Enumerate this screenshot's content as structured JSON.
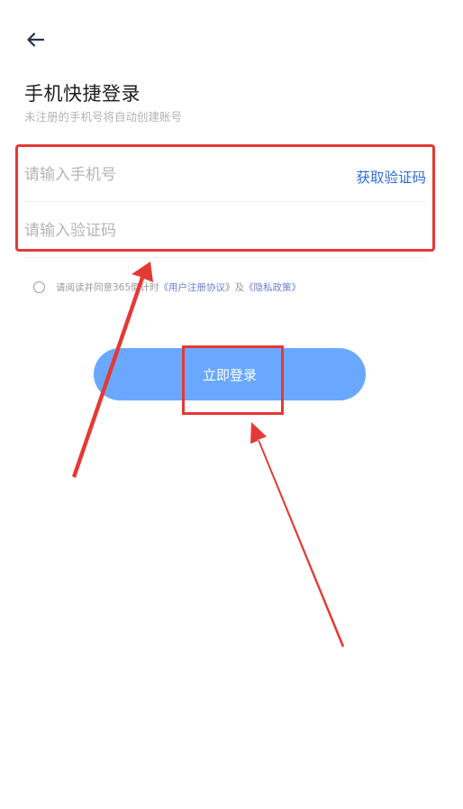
{
  "header": {
    "back_icon": "arrow-left-icon",
    "title": "手机快捷登录",
    "subtitle": "未注册的手机号将自动创建账号"
  },
  "form": {
    "phone_placeholder": "请输入手机号",
    "get_code_label": "获取验证码",
    "code_placeholder": "请输入验证码"
  },
  "agreement": {
    "prefix": "请阅读并同意365倒计时",
    "user_agreement": "《用户注册协议》",
    "connector": "及",
    "privacy_policy": "《隐私政策》"
  },
  "login_button_label": "立即登录",
  "colors": {
    "accent": "#2f6fd8",
    "button": "#6aa8ff",
    "annotation": "#e53935"
  }
}
